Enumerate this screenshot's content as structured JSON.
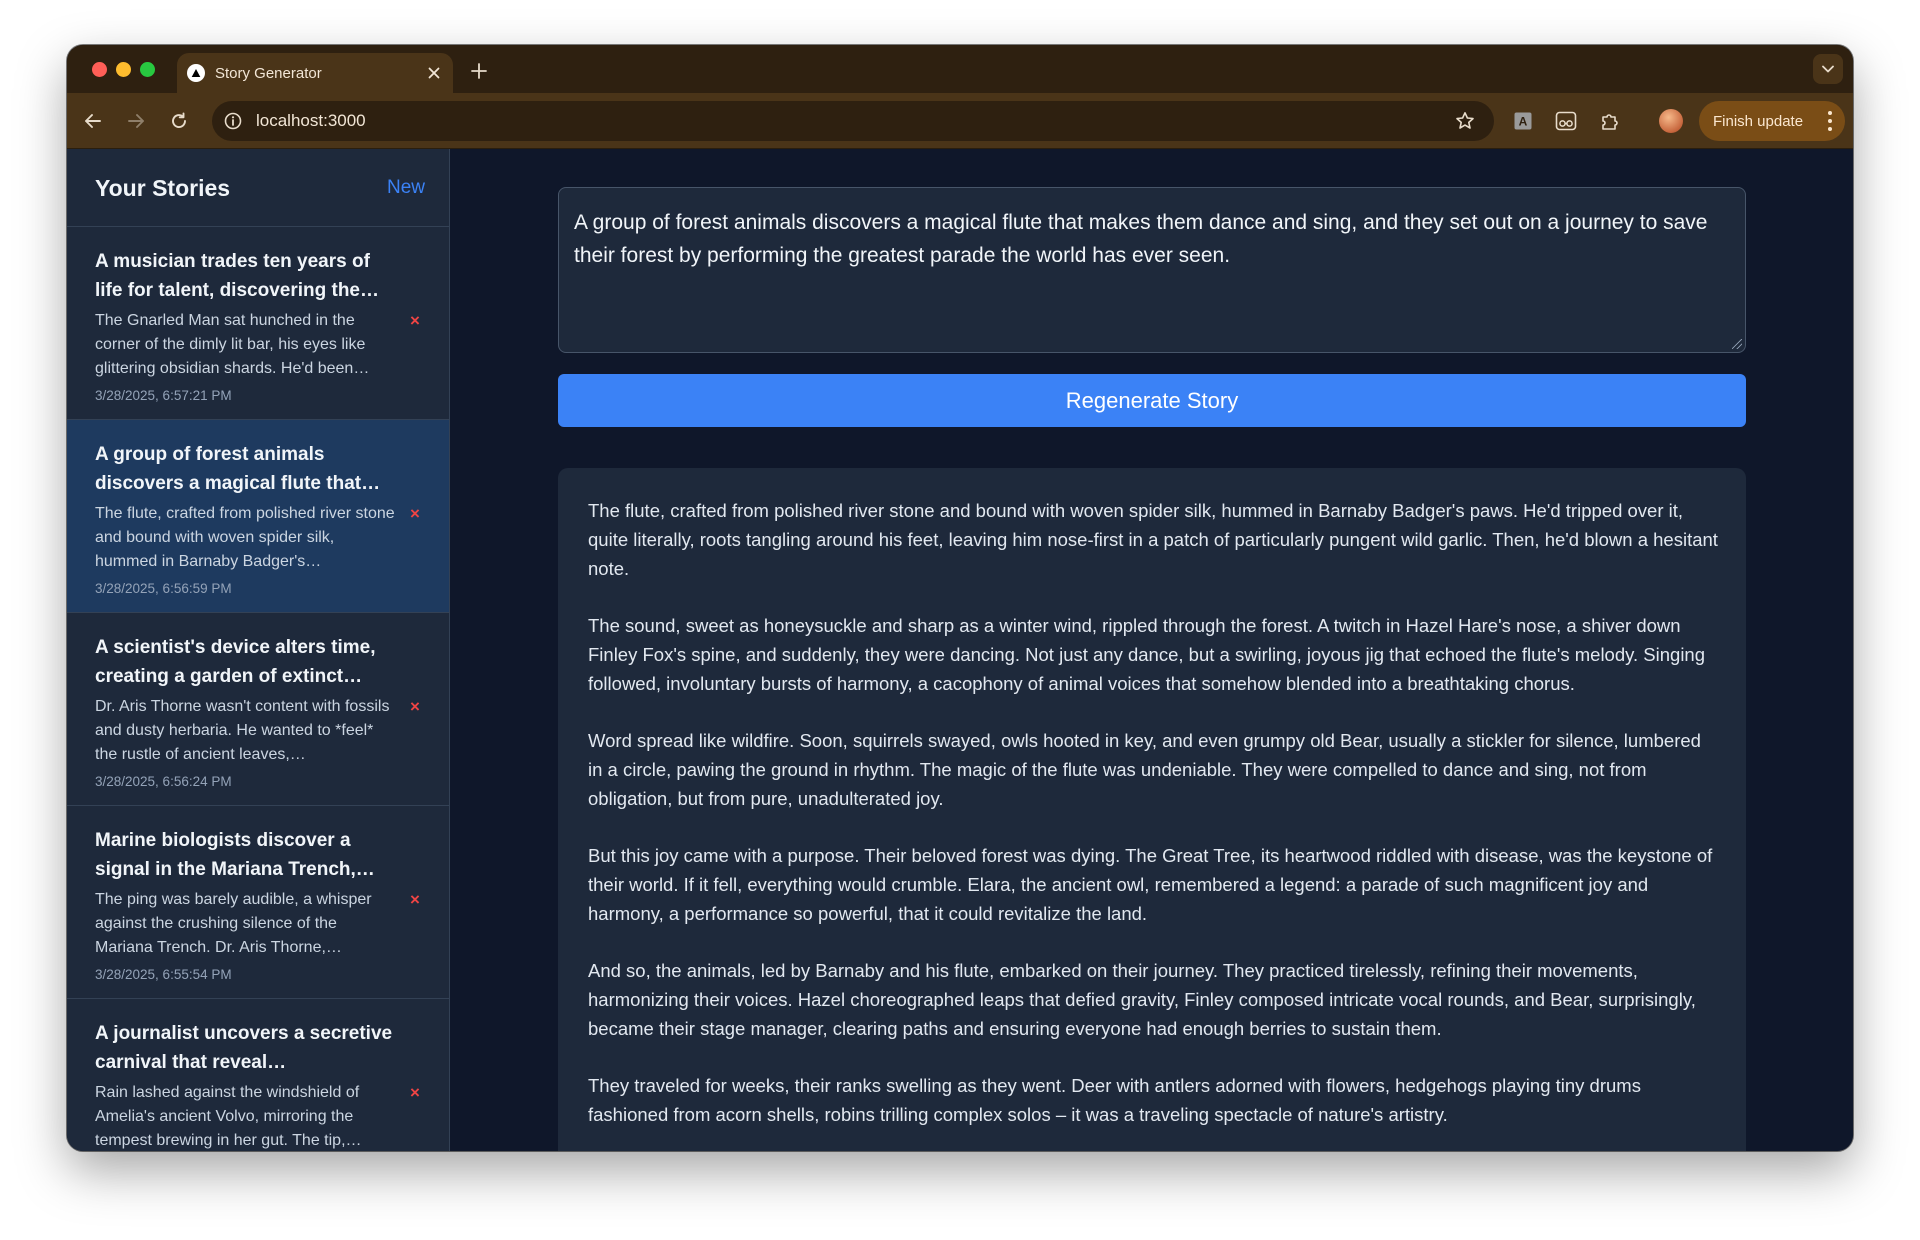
{
  "browser": {
    "tab_title": "Story Generator",
    "url": "localhost:3000",
    "finish_update_label": "Finish update",
    "icons": {
      "favicon": "triangle-icon",
      "back": "arrow-left-icon",
      "forward": "arrow-right-icon",
      "reload": "reload-icon",
      "site_info": "info-icon",
      "bookmark": "star-icon",
      "tab_search": "chevron-down-icon",
      "extensions": [
        "translate-icon",
        "reader-icon",
        "puzzle-icon"
      ]
    }
  },
  "colors": {
    "accent": "#3b82f6",
    "delete": "#ef4444",
    "background": "#0f172a",
    "panel": "#1e293b",
    "active_item": "#1e3a5f"
  },
  "sidebar": {
    "title": "Your Stories",
    "new_label": "New",
    "delete_glyph": "×",
    "items": [
      {
        "title": "A musician trades ten years of life for talent, discovering the…",
        "excerpt": "The Gnarled Man sat hunched in the corner of the dimly lit bar, his eyes like glittering obsidian shards. He'd been…",
        "date": "3/28/2025, 6:57:21 PM",
        "active": false
      },
      {
        "title": "A group of forest animals discovers a magical flute that…",
        "excerpt": "The flute, crafted from polished river stone and bound with woven spider silk, hummed in Barnaby Badger's…",
        "date": "3/28/2025, 6:56:59 PM",
        "active": true
      },
      {
        "title": "A scientist's device alters time, creating a garden of extinct…",
        "excerpt": "Dr. Aris Thorne wasn't content with fossils and dusty herbaria. He wanted to *feel* the rustle of ancient leaves,…",
        "date": "3/28/2025, 6:56:24 PM",
        "active": false
      },
      {
        "title": "Marine biologists discover a signal in the Mariana Trench,…",
        "excerpt": "The ping was barely audible, a whisper against the crushing silence of the Mariana Trench. Dr. Aris Thorne,…",
        "date": "3/28/2025, 6:55:54 PM",
        "active": false
      },
      {
        "title": "A journalist uncovers a secretive carnival that reveal…",
        "excerpt": "Rain lashed against the windshield of Amelia's ancient Volvo, mirroring the tempest brewing in her gut. The tip,…",
        "date": "",
        "active": false
      }
    ]
  },
  "main": {
    "prompt": "A group of forest animals discovers a magical flute that makes them dance and sing, and they set out on a journey to save their forest by performing the greatest parade the world has ever seen.",
    "regenerate_label": "Regenerate Story",
    "story_paragraphs": [
      "The flute, crafted from polished river stone and bound with woven spider silk, hummed in Barnaby Badger's paws. He'd tripped over it, quite literally, roots tangling around his feet, leaving him nose-first in a patch of particularly pungent wild garlic. Then, he'd blown a hesitant note.",
      "The sound, sweet as honeysuckle and sharp as a winter wind, rippled through the forest. A twitch in Hazel Hare's nose, a shiver down Finley Fox's spine, and suddenly, they were dancing. Not just any dance, but a swirling, joyous jig that echoed the flute's melody. Singing followed, involuntary bursts of harmony, a cacophony of animal voices that somehow blended into a breathtaking chorus.",
      "Word spread like wildfire. Soon, squirrels swayed, owls hooted in key, and even grumpy old Bear, usually a stickler for silence, lumbered in a circle, pawing the ground in rhythm. The magic of the flute was undeniable. They were compelled to dance and sing, not from obligation, but from pure, unadulterated joy.",
      "But this joy came with a purpose. Their beloved forest was dying. The Great Tree, its heartwood riddled with disease, was the keystone of their world. If it fell, everything would crumble. Elara, the ancient owl, remembered a legend: a parade of such magnificent joy and harmony, a performance so powerful, that it could revitalize the land.",
      "And so, the animals, led by Barnaby and his flute, embarked on their journey. They practiced tirelessly, refining their movements, harmonizing their voices. Hazel choreographed leaps that defied gravity, Finley composed intricate vocal rounds, and Bear, surprisingly, became their stage manager, clearing paths and ensuring everyone had enough berries to sustain them.",
      "They traveled for weeks, their ranks swelling as they went. Deer with antlers adorned with flowers, hedgehogs playing tiny drums fashioned from acorn shells, robins trilling complex solos – it was a traveling spectacle of nature's artistry."
    ]
  }
}
